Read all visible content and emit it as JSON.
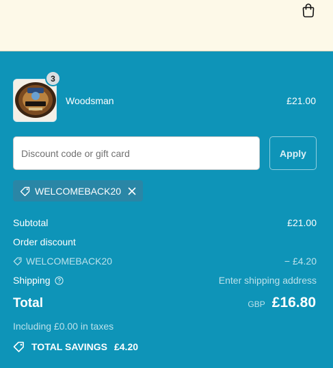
{
  "header": {
    "cart_icon": "shopping-bag-icon"
  },
  "line_item": {
    "name": "Woodsman",
    "price": "£21.00",
    "quantity": "3",
    "image_icon": "product-thumbnail"
  },
  "discount": {
    "placeholder": "Discount code or gift card",
    "value": "",
    "apply_label": "Apply"
  },
  "applied_code": {
    "code": "WELCOMEBACK20",
    "tag_icon": "tag-icon",
    "remove_icon": "close-icon"
  },
  "summary": {
    "subtotal_label": "Subtotal",
    "subtotal_value": "£21.00",
    "order_discount_label": "Order discount",
    "discount_code": "WELCOMEBACK20",
    "discount_value": "− £4.20",
    "shipping_label": "Shipping",
    "shipping_value": "Enter shipping address",
    "total_label": "Total",
    "currency": "GBP",
    "total_value": "£16.80",
    "taxes_note": "Including £0.00 in taxes",
    "savings_label": "TOTAL SAVINGS",
    "savings_value": "£4.20"
  },
  "colors": {
    "panel": "#0e94b8",
    "header": "#fdf9e8",
    "chip": "#2a86a6"
  }
}
